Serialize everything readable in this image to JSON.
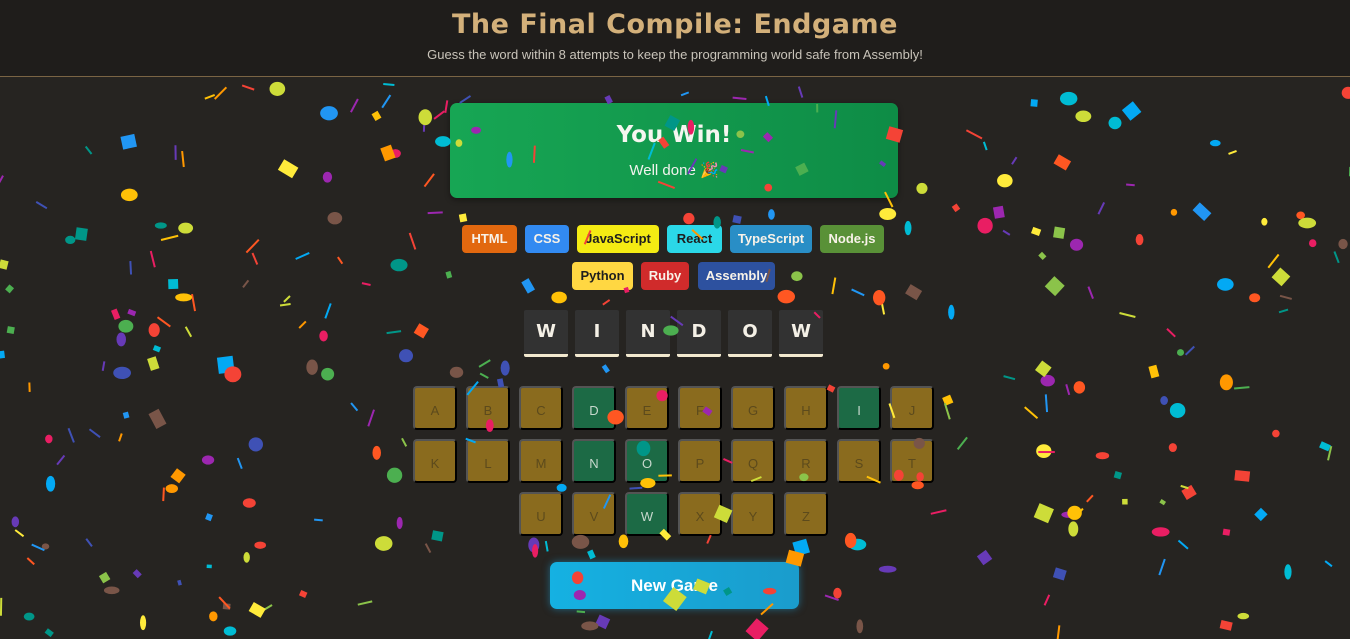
{
  "header": {
    "title": "The Final Compile: Endgame",
    "subtitle": "Guess the word within 8 attempts to keep the programming world safe from Assembly!"
  },
  "status": {
    "title": "You Win!",
    "message": "Well done 🎉"
  },
  "languages": [
    {
      "name": "HTML",
      "bg": "#e2680f",
      "fg": "#f8f2e8"
    },
    {
      "name": "CSS",
      "bg": "#328af1",
      "fg": "#f8f2e8"
    },
    {
      "name": "JavaScript",
      "bg": "#f4eb13",
      "fg": "#1e1e1e"
    },
    {
      "name": "React",
      "bg": "#2bd8e8",
      "fg": "#1e1e1e"
    },
    {
      "name": "TypeScript",
      "bg": "#298ec6",
      "fg": "#f8f2e8"
    },
    {
      "name": "Node.js",
      "bg": "#599137",
      "fg": "#f8f2e8"
    },
    {
      "name": "Python",
      "bg": "#ffd742",
      "fg": "#1e1e1e"
    },
    {
      "name": "Ruby",
      "bg": "#d02b2b",
      "fg": "#f8f2e8"
    },
    {
      "name": "Assembly",
      "bg": "#2d519f",
      "fg": "#f8f2e8"
    }
  ],
  "word": [
    "W",
    "I",
    "N",
    "D",
    "O",
    "W"
  ],
  "keyboard": [
    {
      "letter": "A",
      "state": "unused"
    },
    {
      "letter": "B",
      "state": "unused"
    },
    {
      "letter": "C",
      "state": "unused"
    },
    {
      "letter": "D",
      "state": "correct"
    },
    {
      "letter": "E",
      "state": "unused"
    },
    {
      "letter": "F",
      "state": "unused"
    },
    {
      "letter": "G",
      "state": "unused"
    },
    {
      "letter": "H",
      "state": "unused"
    },
    {
      "letter": "I",
      "state": "correct"
    },
    {
      "letter": "J",
      "state": "unused"
    },
    {
      "letter": "K",
      "state": "unused"
    },
    {
      "letter": "L",
      "state": "unused"
    },
    {
      "letter": "M",
      "state": "unused"
    },
    {
      "letter": "N",
      "state": "correct"
    },
    {
      "letter": "O",
      "state": "correct"
    },
    {
      "letter": "P",
      "state": "unused"
    },
    {
      "letter": "Q",
      "state": "unused"
    },
    {
      "letter": "R",
      "state": "unused"
    },
    {
      "letter": "S",
      "state": "unused"
    },
    {
      "letter": "T",
      "state": "unused"
    },
    {
      "letter": "U",
      "state": "unused"
    },
    {
      "letter": "V",
      "state": "unused"
    },
    {
      "letter": "W",
      "state": "correct"
    },
    {
      "letter": "X",
      "state": "unused"
    },
    {
      "letter": "Y",
      "state": "unused"
    },
    {
      "letter": "Z",
      "state": "unused"
    }
  ],
  "new_game_label": "New Game",
  "colors": {
    "background": "#262421",
    "accent": "#d3b07a",
    "win": "#17a654",
    "key_unused": "#8a6b1e",
    "key_correct": "#1c6a45",
    "button": "#15b1e2"
  },
  "confetti_colors": [
    "#f44336",
    "#e91e63",
    "#9c27b0",
    "#673ab7",
    "#3f51b5",
    "#2196f3",
    "#03a9f4",
    "#00bcd4",
    "#009688",
    "#4caf50",
    "#8bc34a",
    "#cddc39",
    "#ffeb3b",
    "#ffc107",
    "#ff9800",
    "#ff5722",
    "#795548"
  ]
}
